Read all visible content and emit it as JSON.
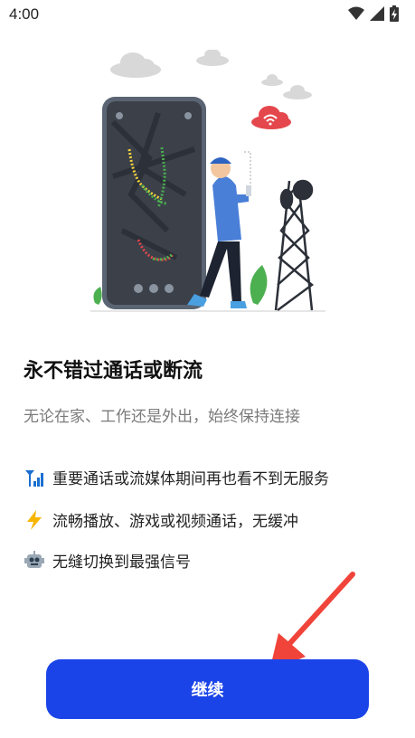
{
  "status_bar": {
    "time": "4:00"
  },
  "title": "永不错过通话或断流",
  "subtitle": "无论在家、工作还是外出，始终保持连接",
  "features": [
    {
      "icon": "signal-bars-icon",
      "text": "重要通话或流媒体期间再也看不到无服务"
    },
    {
      "icon": "lightning-icon",
      "text": "流畅播放、游戏或视频通话，无缓冲"
    },
    {
      "icon": "robot-icon",
      "text": "无缝切换到最强信号"
    }
  ],
  "continue_label": "继续",
  "colors": {
    "accent": "#1b44e8",
    "arrow": "#f0443a"
  }
}
